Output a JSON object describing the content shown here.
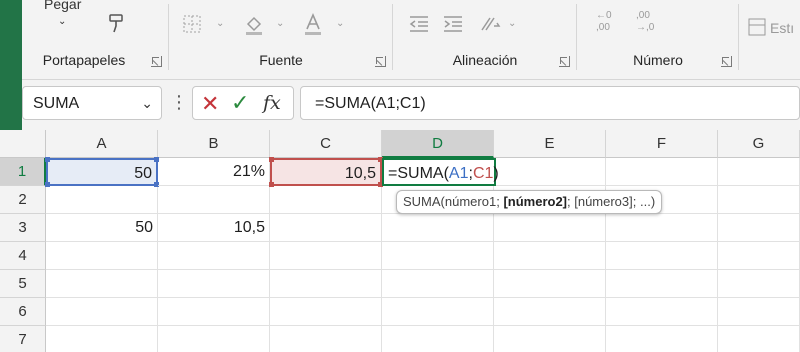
{
  "ribbon": {
    "clipboard": {
      "paste_label": "Pegar",
      "group_label": "Portapapeles"
    },
    "font": {
      "group_label": "Fuente"
    },
    "alignment": {
      "group_label": "Alineación"
    },
    "number": {
      "group_label": "Número",
      "inc_decimal_top": "←0",
      "inc_decimal_bottom": ",00",
      "dec_decimal_top": ",00",
      "dec_decimal_bottom": "→,0"
    },
    "styles": {
      "partial_label": "Estı"
    }
  },
  "formula_bar": {
    "name_box": "SUMA",
    "cancel_icon": "✕",
    "enter_icon": "✓",
    "fx_label": "fx",
    "formula": "=SUMA(A1;C1)"
  },
  "grid": {
    "columns": [
      "A",
      "B",
      "C",
      "D",
      "E",
      "F",
      "G"
    ],
    "rows": [
      "1",
      "2",
      "3",
      "4",
      "5",
      "6",
      "7"
    ],
    "cells": {
      "A1": "50",
      "B1": "21%",
      "C1": "10,5",
      "A3": "50",
      "B3": "10,5"
    },
    "edit_formula": {
      "prefix": "=SUMA(",
      "ref1": "A1",
      "sep": ";",
      "ref2": "C1",
      "suffix": ")"
    }
  },
  "tooltip": {
    "func": "SUMA(",
    "arg1": "número1; ",
    "arg2": "[número2]",
    "rest": "; [número3]; ...)"
  },
  "colors": {
    "excel_green": "#107c41",
    "ref_blue": "#4a72c4",
    "ref_red": "#c0504d"
  }
}
